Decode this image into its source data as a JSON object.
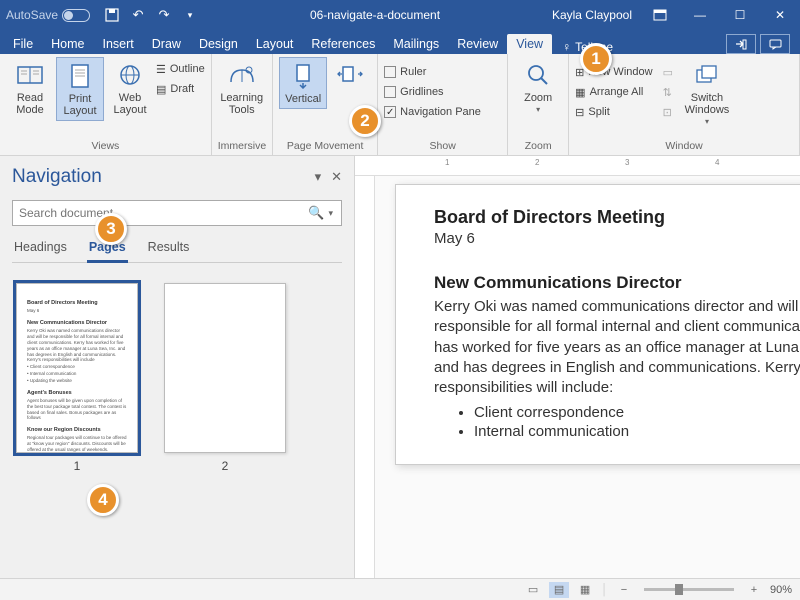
{
  "title_bar": {
    "autosave_label": "AutoSave",
    "doc_title": "06-navigate-a-document",
    "user_name": "Kayla Claypool"
  },
  "tabs": {
    "items": [
      "File",
      "Home",
      "Insert",
      "Draw",
      "Design",
      "Layout",
      "References",
      "Mailings",
      "Review",
      "View"
    ],
    "active": "View",
    "tell_me": "Tell me"
  },
  "ribbon": {
    "views": {
      "label": "Views",
      "read_mode": "Read Mode",
      "print_layout": "Print Layout",
      "web_layout": "Web Layout",
      "outline": "Outline",
      "draft": "Draft"
    },
    "immersive": {
      "label": "Immersive",
      "learning_tools": "Learning Tools"
    },
    "page_movement": {
      "label": "Page Movement",
      "vertical": "Vertical",
      "side": "Side to Side"
    },
    "show": {
      "label": "Show",
      "ruler": "Ruler",
      "gridlines": "Gridlines",
      "nav_pane": "Navigation Pane"
    },
    "zoom": {
      "label": "Zoom",
      "zoom_btn": "Zoom"
    },
    "window": {
      "label": "Window",
      "new_window": "New Window",
      "arrange_all": "Arrange All",
      "split": "Split",
      "switch": "Switch Windows"
    }
  },
  "nav_pane": {
    "title": "Navigation",
    "search_placeholder": "Search document",
    "tabs": {
      "headings": "Headings",
      "pages": "Pages",
      "results": "Results"
    },
    "thumbs": [
      "1",
      "2"
    ]
  },
  "document": {
    "h1": "Board of Directors Meeting",
    "date": "May 6",
    "h2": "New Communications Director",
    "para": "Kerry Oki was named communications director and will be responsible for all formal internal and client communications. Kerry has worked for five years as an office manager at Luna Sea, Inc. and has degrees in English and communications. Kerry's responsibilities will include:",
    "bullets": [
      "Client correspondence",
      "Internal communication"
    ]
  },
  "status": {
    "zoom_pct": "90%"
  },
  "callouts": {
    "c1": "1",
    "c2": "2",
    "c3": "3",
    "c4": "4"
  }
}
